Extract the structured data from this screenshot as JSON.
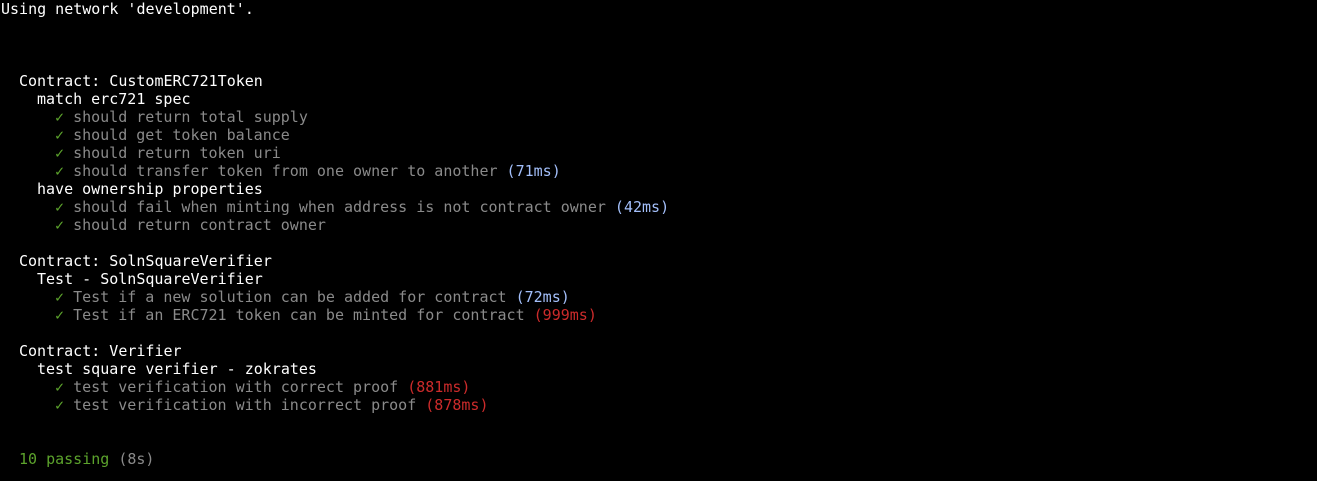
{
  "network_line": "Using network 'development'.",
  "colors": {
    "background": "#000000",
    "text": "#ffffff",
    "test_text": "#8a8a8a",
    "check": "#5ca32c",
    "fast_duration": "#a3bffa",
    "slow_duration": "#cc2b2b",
    "passing": "#5ca32c"
  },
  "check_icon": "✓",
  "contracts": [
    {
      "title": "Contract: CustomERC721Token",
      "groups": [
        {
          "title": "match erc721 spec",
          "tests": [
            {
              "text": "should return total supply",
              "duration": ""
            },
            {
              "text": "should get token balance",
              "duration": ""
            },
            {
              "text": "should return token uri",
              "duration": ""
            },
            {
              "text": "should transfer token from one owner to another",
              "duration": "(71ms)"
            }
          ]
        },
        {
          "title": "have ownership properties",
          "tests": [
            {
              "text": "should fail when minting when address is not contract owner",
              "duration": "(42ms)"
            },
            {
              "text": "should return contract owner",
              "duration": ""
            }
          ]
        }
      ]
    },
    {
      "title": "Contract: SolnSquareVerifier",
      "groups": [
        {
          "title": "Test - SolnSquareVerifier",
          "tests": [
            {
              "text": "Test if a new solution can be added for contract",
              "duration": "(72ms)"
            },
            {
              "text": "Test if an ERC721 token can be minted for contract",
              "duration": "(999ms)"
            }
          ]
        }
      ]
    },
    {
      "title": "Contract: Verifier",
      "groups": [
        {
          "title": "test square verifier - zokrates",
          "tests": [
            {
              "text": "test verification with correct proof",
              "duration": "(881ms)"
            },
            {
              "text": "test verification with incorrect proof",
              "duration": "(878ms)"
            }
          ]
        }
      ]
    }
  ],
  "summary": {
    "passing": "10 passing",
    "time": "(8s)"
  }
}
